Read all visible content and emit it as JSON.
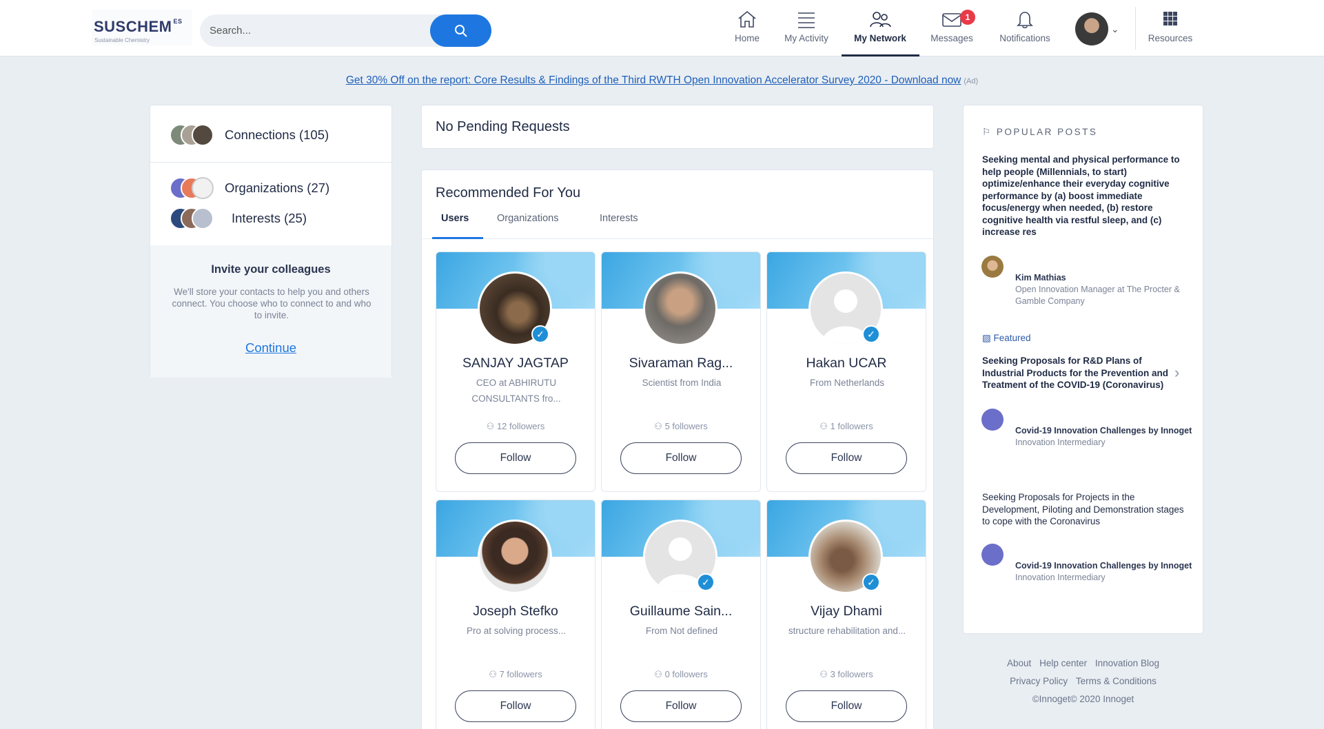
{
  "header": {
    "logo_text": "SUSCHEM",
    "logo_suffix": "ES",
    "logo_tagline": "Sustainable Chemistry",
    "search_placeholder": "Search...",
    "nav": [
      {
        "label": "Home",
        "icon": "home-icon"
      },
      {
        "label": "My Activity",
        "icon": "activity-icon"
      },
      {
        "label": "My Network",
        "icon": "network-icon",
        "active": true
      },
      {
        "label": "Messages",
        "icon": "messages-icon",
        "badge": "1"
      },
      {
        "label": "Notifications",
        "icon": "bell-icon"
      },
      {
        "label": "Resources",
        "icon": "grid-icon"
      }
    ]
  },
  "promo": {
    "text": "Get 30% Off on the report: Core Results & Findings of the Third RWTH Open Innovation Accelerator Survey 2020 - Download now",
    "ad_label": "(Ad)"
  },
  "left": {
    "connections": "Connections (105)",
    "organizations": "Organizations (27)",
    "interests": "Interests (25)",
    "invite_title": "Invite your colleagues",
    "invite_text": "We'll store your contacts to help you and others connect. You choose who to connect to and who to invite.",
    "invite_cta": "Continue"
  },
  "pending": {
    "text": "No Pending Requests"
  },
  "recommended": {
    "title": "Recommended For You",
    "tabs": [
      "Users",
      "Organizations",
      "Interests"
    ],
    "follow_label": "Follow",
    "users": [
      {
        "name": "SANJAY JAGTAP",
        "desc": "CEO at ABHIRUTU CONSULTANTS fro...",
        "followers": "12 followers",
        "verified": true
      },
      {
        "name": "Sivaraman Rag...",
        "desc": "Scientist from India",
        "followers": "5 followers",
        "verified": false
      },
      {
        "name": "Hakan UCAR",
        "desc": "From Netherlands",
        "followers": "1 followers",
        "verified": true
      },
      {
        "name": "Joseph Stefko",
        "desc": "Pro at solving process...",
        "followers": "7 followers",
        "verified": false
      },
      {
        "name": "Guillaume Sain...",
        "desc": "From Not defined",
        "followers": "0 followers",
        "verified": true
      },
      {
        "name": "Vijay Dhami",
        "desc": "structure rehabilitation and...",
        "followers": "3 followers",
        "verified": true
      }
    ]
  },
  "popular": {
    "title": "POPULAR POSTS",
    "post1": "Seeking mental and physical performance to help people (Millennials, to start) optimize/enhance their everyday cognitive performance by (a) boost immediate focus/energy when needed, (b) restore cognitive health via restful sleep, and (c) increase res",
    "author1_name": "Kim Mathias",
    "author1_role": "Open Innovation Manager at The Procter & Gamble Company",
    "featured": "Featured",
    "post2": "Seeking Proposals for R&D Plans of Industrial Products for the Prevention and Treatment of the COVID-19 (Coronavirus)",
    "author2_name": "Covid-19 Innovation Challenges by Innoget",
    "author2_role": "Innovation Intermediary",
    "post3": "Seeking Proposals for Projects in the Development, Piloting and Demonstration stages to cope with the Coronavirus",
    "author3_name": "Covid-19 Innovation Challenges by Innoget",
    "author3_role": "Innovation Intermediary"
  },
  "footer": {
    "links1": [
      "About",
      "Help center",
      "Innovation Blog"
    ],
    "links2": [
      "Privacy Policy",
      "Terms & Conditions"
    ],
    "copyright": "©Innoget© 2020 Innoget"
  },
  "colors": {
    "accent": "#1e77e0",
    "badge": "#e83a48",
    "navy": "#1f2a44",
    "background": "#e9eef3"
  }
}
